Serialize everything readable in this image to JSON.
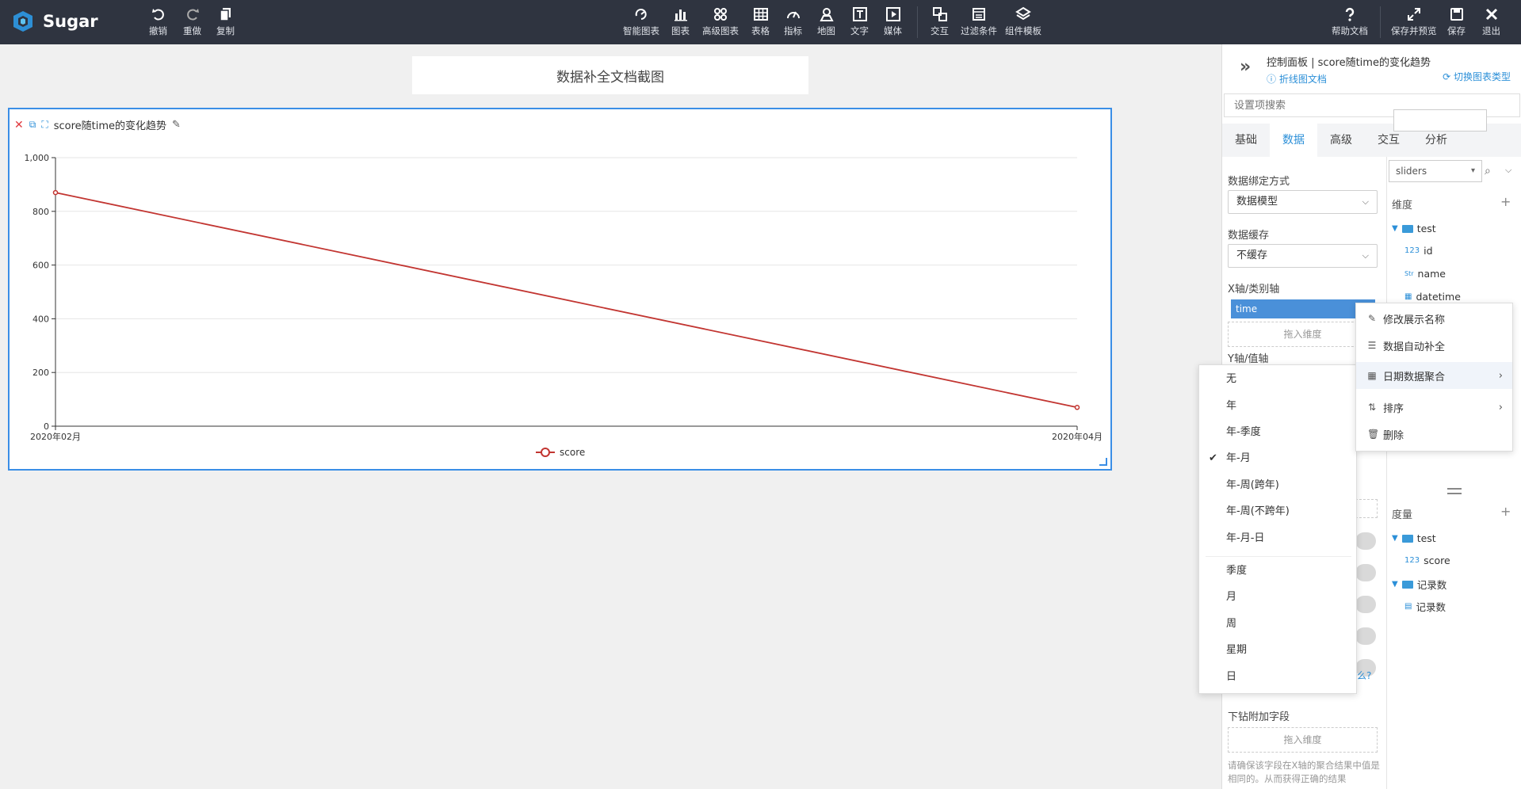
{
  "app": {
    "name": "Sugar"
  },
  "toolbar": {
    "undo": "撤销",
    "redo": "重做",
    "copy": "复制",
    "smart_chart": "智能图表",
    "chart": "图表",
    "advanced_chart": "高级图表",
    "table": "表格",
    "indicator": "指标",
    "map": "地图",
    "text": "文字",
    "media": "媒体",
    "interaction": "交互",
    "filter": "过滤条件",
    "component_template": "组件模板",
    "help": "帮助文档",
    "save_preview": "保存并预览",
    "save": "保存",
    "exit": "退出"
  },
  "canvas": {
    "page_title": "数据补全文档截图",
    "card_title": "score随time的变化趋势"
  },
  "chart_data": {
    "type": "line",
    "x": [
      "2020年02月",
      "2020年04月"
    ],
    "series": [
      {
        "name": "score",
        "values": [
          870,
          70
        ]
      }
    ],
    "yticks": [
      "0",
      "200",
      "400",
      "600",
      "800",
      "1,000"
    ],
    "ylim": [
      0,
      1000
    ],
    "legend": "bottom-center",
    "color": "#c23531"
  },
  "panel": {
    "title": "控制面板 | score随time的变化趋势",
    "doc_link": "折线图文档",
    "switch_link": "切换图表类型",
    "search_placeholder": "设置项搜索",
    "tabs": [
      "基础",
      "数据",
      "高级",
      "交互",
      "分析"
    ],
    "active_tab": "数据",
    "binding_label": "数据绑定方式",
    "binding_value": "数据模型",
    "cache_label": "数据缓存",
    "cache_value": "不缓存",
    "x_axis_label": "X轴/类别轴",
    "x_axis_field": "time",
    "drop_dim": "拖入维度",
    "y_axis_label": "Y轴/值轴",
    "help_suffix": "么?",
    "drill_label": "下钻附加字段",
    "drill_drop": "拖入维度",
    "drill_hint": "请确保该字段在X轴的聚合结果中值是相同的。从而获得正确的结果"
  },
  "fields": {
    "dataset": "sliders",
    "dimensions_title": "维度",
    "dimension_group": "test",
    "dimension_items": [
      {
        "type": "123",
        "name": "id"
      },
      {
        "type": "Str",
        "name": "name"
      },
      {
        "type": "date",
        "name": "datetime"
      }
    ],
    "measures_title": "度量",
    "measure_group": "test",
    "measure_items": [
      {
        "type": "123",
        "name": "score"
      }
    ],
    "count_group": "记录数",
    "count_item": "记录数"
  },
  "context_menu": {
    "items": [
      "修改展示名称",
      "数据自动补全",
      "日期数据聚合",
      "排序",
      "删除"
    ]
  },
  "date_menu": {
    "items": [
      "无",
      "年",
      "年-季度",
      "年-月",
      "年-周(跨年)",
      "年-周(不跨年)",
      "年-月-日",
      "季度",
      "月",
      "周",
      "星期",
      "日"
    ],
    "selected": "年-月"
  }
}
